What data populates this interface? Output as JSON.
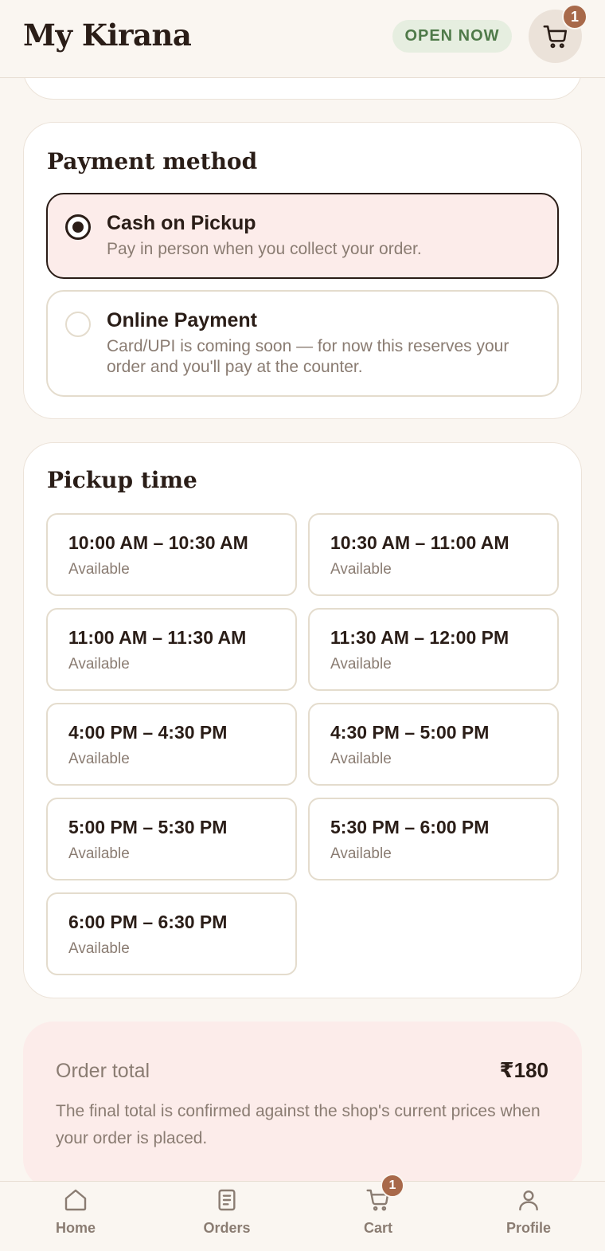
{
  "header": {
    "brand": "My Kirana",
    "status_badge": "OPEN NOW",
    "cart_count": "1"
  },
  "payment": {
    "title": "Payment method",
    "options": [
      {
        "label": "Cash on Pickup",
        "description": "Pay in person when you collect your order.",
        "selected": true
      },
      {
        "label": "Online Payment",
        "description": "Card/UPI is coming soon — for now this reserves your order and you'll pay at the counter.",
        "selected": false
      }
    ]
  },
  "pickup": {
    "title": "Pickup time",
    "slots": [
      {
        "time": "10:00 AM – 10:30 AM",
        "status": "Available"
      },
      {
        "time": "10:30 AM – 11:00 AM",
        "status": "Available"
      },
      {
        "time": "11:00 AM – 11:30 AM",
        "status": "Available"
      },
      {
        "time": "11:30 AM – 12:00 PM",
        "status": "Available"
      },
      {
        "time": "4:00 PM – 4:30 PM",
        "status": "Available"
      },
      {
        "time": "4:30 PM – 5:00 PM",
        "status": "Available"
      },
      {
        "time": "5:00 PM – 5:30 PM",
        "status": "Available"
      },
      {
        "time": "5:30 PM – 6:00 PM",
        "status": "Available"
      },
      {
        "time": "6:00 PM – 6:30 PM",
        "status": "Available"
      }
    ]
  },
  "order_total": {
    "label": "Order total",
    "amount": "₹180",
    "note": "The final total is confirmed against the shop's current prices when your order is placed."
  },
  "nav": {
    "items": [
      {
        "label": "Home",
        "icon": "home-icon"
      },
      {
        "label": "Orders",
        "icon": "orders-icon"
      },
      {
        "label": "Cart",
        "icon": "cart-icon"
      },
      {
        "label": "Profile",
        "icon": "profile-icon"
      }
    ],
    "cart_count": "1"
  },
  "colors": {
    "background": "#faf6f1",
    "accent": "#a8694a",
    "selected_fill": "#fcecea",
    "open_badge": "#4f7a49",
    "text": "#2a1d17",
    "muted": "#8a7c72"
  }
}
